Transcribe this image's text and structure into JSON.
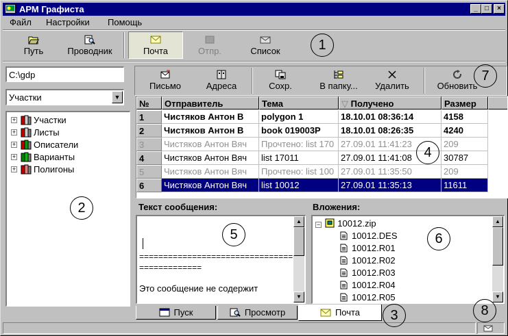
{
  "window": {
    "title": "АРМ Графиста",
    "min": "_",
    "max": "□",
    "close": "×"
  },
  "menu": [
    "Файл",
    "Настройки",
    "Помощь"
  ],
  "toolbar": [
    {
      "label": "Путь",
      "icon": "folder-open-icon",
      "state": "normal"
    },
    {
      "label": "Проводник",
      "icon": "explorer-icon",
      "state": "normal"
    },
    {
      "label": "Почта",
      "icon": "envelope-icon",
      "state": "pressed"
    },
    {
      "label": "Отпр.",
      "icon": "send-icon",
      "state": "disabled"
    },
    {
      "label": "Список",
      "icon": "envelope-list-icon",
      "state": "normal"
    }
  ],
  "left": {
    "path_value": "C:\\gdp",
    "combo_value": "Участки",
    "tree": [
      "Участки",
      "Листы",
      "Описатели",
      "Варианты",
      "Полигоны"
    ]
  },
  "mail_toolbar": [
    {
      "label": "Письмо",
      "icon": "new-letter-icon"
    },
    {
      "label": "Адреса",
      "icon": "address-book-icon"
    },
    {
      "label": "Сохр.",
      "icon": "save-icon"
    },
    {
      "label": "В папку...",
      "icon": "move-to-folder-icon"
    },
    {
      "label": "Удалить",
      "icon": "delete-icon"
    },
    {
      "label": "Обновить",
      "icon": "refresh-icon"
    }
  ],
  "grid": {
    "headers": [
      "№",
      "Отправитель",
      "Тема",
      "Получено",
      "Размер"
    ],
    "sort_marker": "▽",
    "rows": [
      {
        "n": "1",
        "from": "Чистяков Антон В",
        "subject": "polygon 1",
        "received": "18.10.01 08:36:14",
        "size": "4158",
        "style": "bold"
      },
      {
        "n": "2",
        "from": "Чистяков Антон В",
        "subject": "book 019003P",
        "received": "18.10.01 08:26:35",
        "size": "4240",
        "style": "bold"
      },
      {
        "n": "3",
        "from": "Чистяков Антон Вяч",
        "subject": "Прочтено: list 170",
        "received": "27.09.01 11:41:23",
        "size": "209",
        "style": "gray"
      },
      {
        "n": "4",
        "from": "Чистяков Антон Вяч",
        "subject": "list 17011",
        "received": "27.09.01 11:41:08",
        "size": "30787",
        "style": "normal"
      },
      {
        "n": "5",
        "from": "Чистяков Антон Вяч",
        "subject": "Прочтено: list 100",
        "received": "27.09.01 11:35:50",
        "size": "209",
        "style": "gray"
      },
      {
        "n": "6",
        "from": "Чистяков Антон Вяч",
        "subject": "list 10012",
        "received": "27.09.01 11:35:13",
        "size": "11611",
        "style": "sel"
      }
    ]
  },
  "message": {
    "label": "Текст сообщения:",
    "line1": "================================",
    "line2": "=============",
    "line3": "Это сообщение не содержит"
  },
  "attachments": {
    "label": "Вложения:",
    "root": "10012.zip",
    "files": [
      "10012.DES",
      "10012.R01",
      "10012.R02",
      "10012.R03",
      "10012.R04",
      "10012.R05"
    ]
  },
  "tabs": [
    {
      "label": "Пуск",
      "icon": "window-icon",
      "active": false
    },
    {
      "label": "Просмотр",
      "icon": "preview-icon",
      "active": false
    },
    {
      "label": "Почта",
      "icon": "envelope-icon",
      "active": true
    }
  ],
  "callouts": [
    "1",
    "2",
    "3",
    "4",
    "5",
    "6",
    "7",
    "8"
  ],
  "colors": {
    "titlebar": "#000080",
    "selection": "#000080",
    "face": "#c0c0c0"
  }
}
